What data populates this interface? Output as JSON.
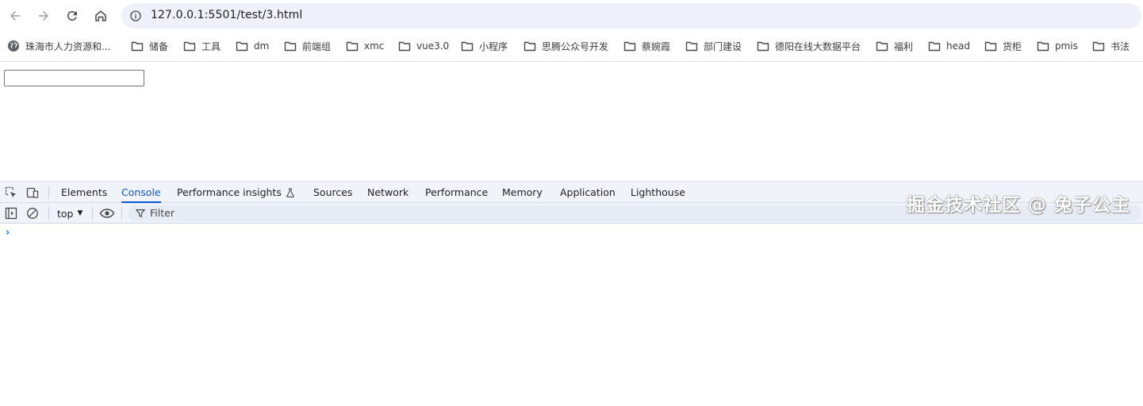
{
  "browser": {
    "url": "127.0.0.1:5501/test/3.html"
  },
  "bookmarks": [
    {
      "label": "珠海市人力资源和...",
      "icon": "globe-icon"
    },
    {
      "label": "储备",
      "icon": "folder-icon"
    },
    {
      "label": "工具",
      "icon": "folder-icon"
    },
    {
      "label": "dm",
      "icon": "folder-icon"
    },
    {
      "label": "前端组",
      "icon": "folder-icon"
    },
    {
      "label": "xmc",
      "icon": "folder-icon"
    },
    {
      "label": "vue3.0",
      "icon": "folder-icon"
    },
    {
      "label": "小程序",
      "icon": "folder-icon"
    },
    {
      "label": "思腾公众号开发",
      "icon": "folder-icon"
    },
    {
      "label": "蔡婉霞",
      "icon": "folder-icon"
    },
    {
      "label": "部门建设",
      "icon": "folder-icon"
    },
    {
      "label": "德阳在线大数据平台",
      "icon": "folder-icon"
    },
    {
      "label": "福利",
      "icon": "folder-icon"
    },
    {
      "label": "head",
      "icon": "folder-icon"
    },
    {
      "label": "货柜",
      "icon": "folder-icon"
    },
    {
      "label": "pmis",
      "icon": "folder-icon"
    },
    {
      "label": "书法",
      "icon": "folder-icon"
    }
  ],
  "page": {
    "input_value": ""
  },
  "devtools": {
    "tabs": [
      {
        "label": "Elements",
        "active": false
      },
      {
        "label": "Console",
        "active": true
      },
      {
        "label": "Performance insights",
        "active": false,
        "icon": "flask-icon"
      },
      {
        "label": "Sources",
        "active": false
      },
      {
        "label": "Network",
        "active": false
      },
      {
        "label": "Performance",
        "active": false
      },
      {
        "label": "Memory",
        "active": false
      },
      {
        "label": "Application",
        "active": false
      },
      {
        "label": "Lighthouse",
        "active": false
      }
    ],
    "console": {
      "context": "top",
      "filter_placeholder": "Filter",
      "prompt": "›"
    },
    "accent_color": "#0b57d0"
  },
  "watermark": "掘金技术社区 @ 兔子公主"
}
